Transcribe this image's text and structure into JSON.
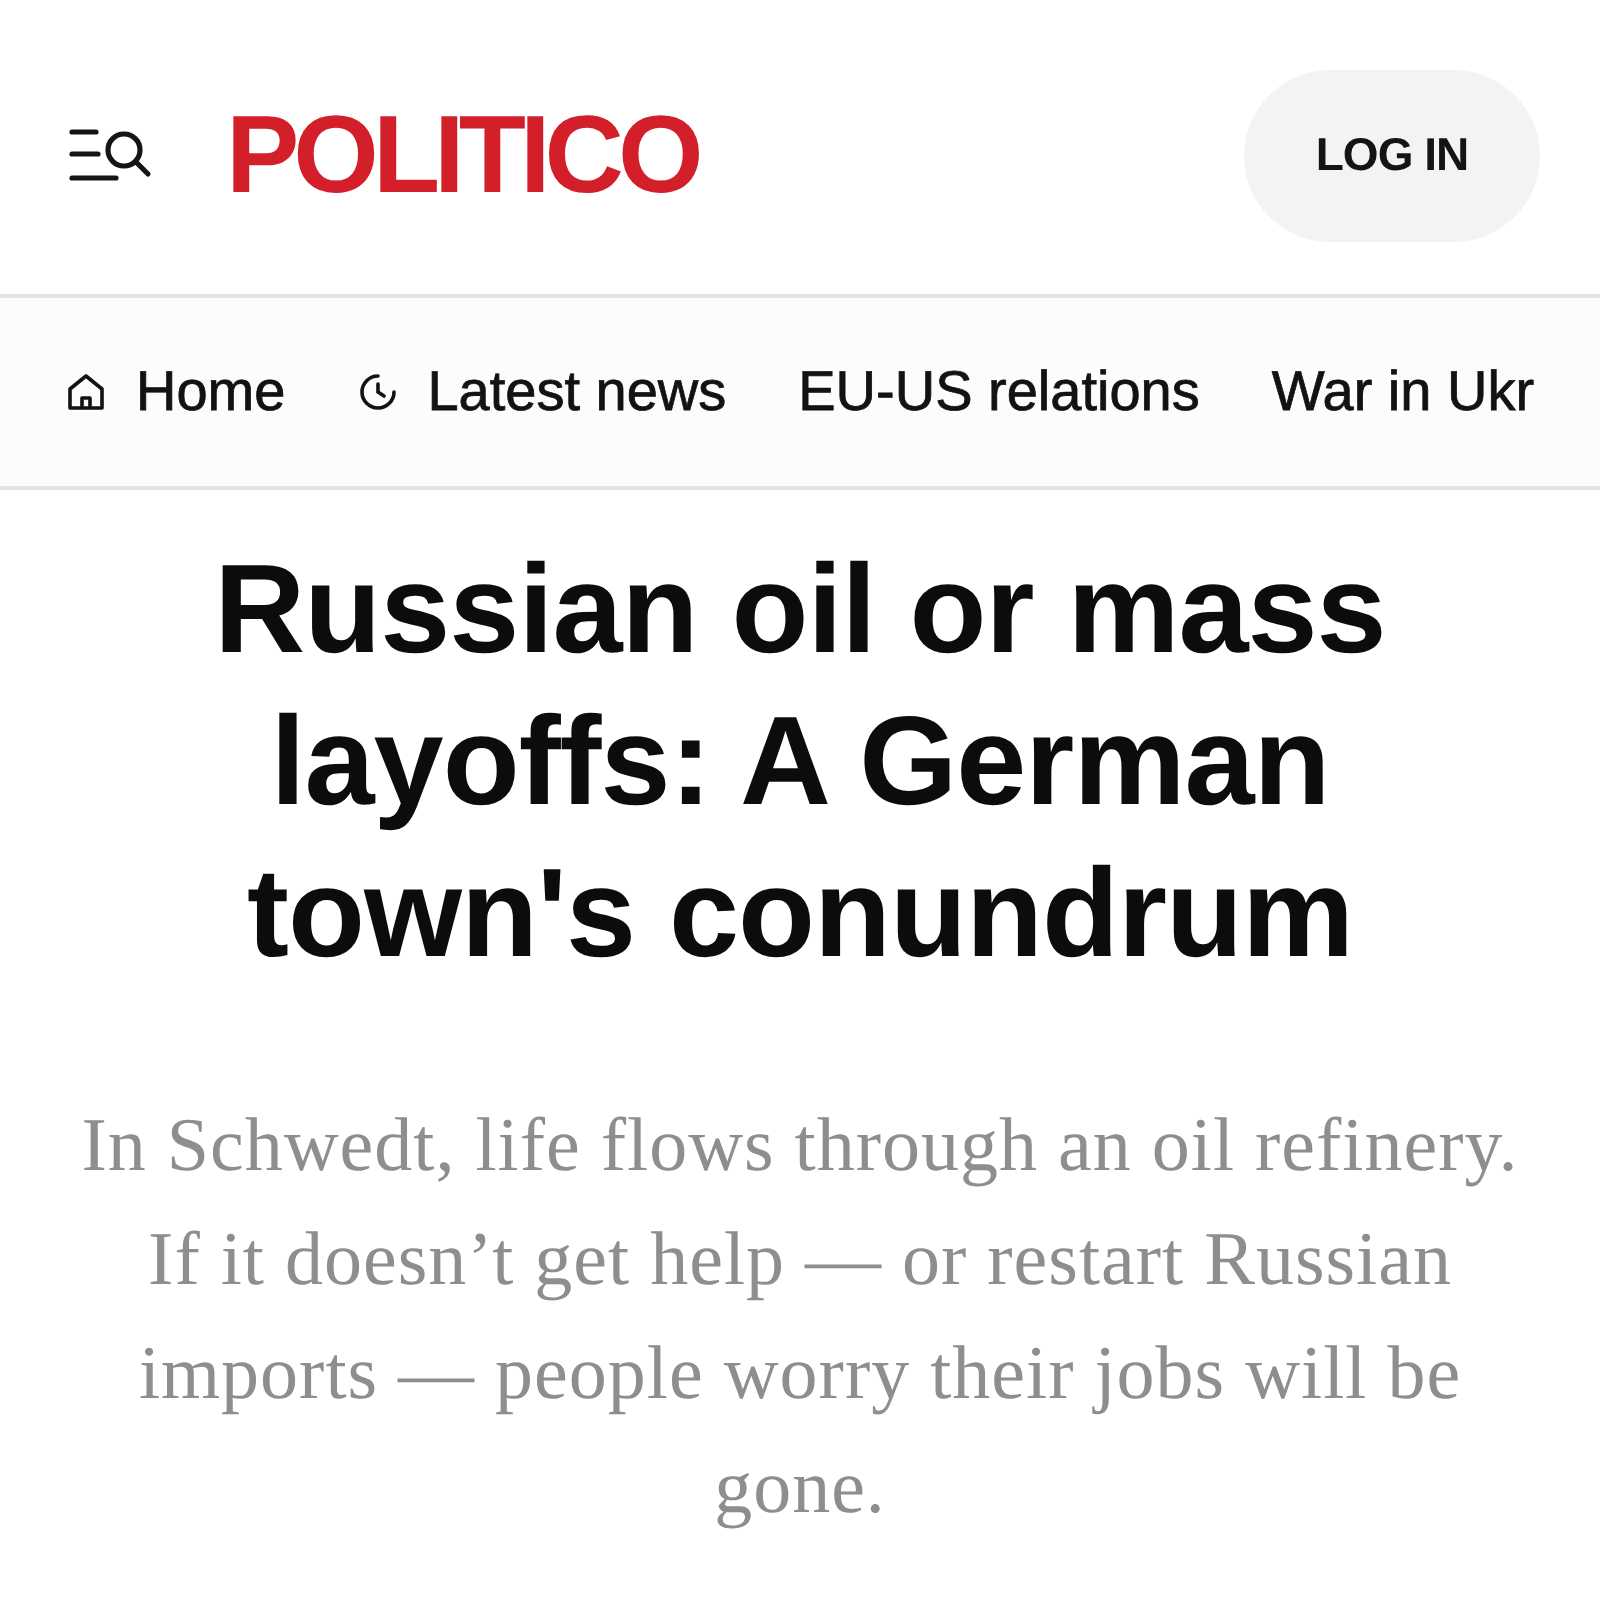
{
  "header": {
    "logo": "POLITICO",
    "login_button": "LOG IN"
  },
  "nav": {
    "items": [
      {
        "label": "Home",
        "kind": "home"
      },
      {
        "label": "Latest news",
        "kind": "latest"
      },
      {
        "label": "EU-US relations",
        "kind": "plain"
      },
      {
        "label": "War in Ukr",
        "kind": "plain"
      }
    ]
  },
  "article": {
    "headline": "Russian oil or mass layoffs: A German town's conundrum",
    "dek": "In Schwedt, life flows through an oil refinery. If it doesn’t get help — or restart Russian imports — people worry their jobs will be gone."
  }
}
